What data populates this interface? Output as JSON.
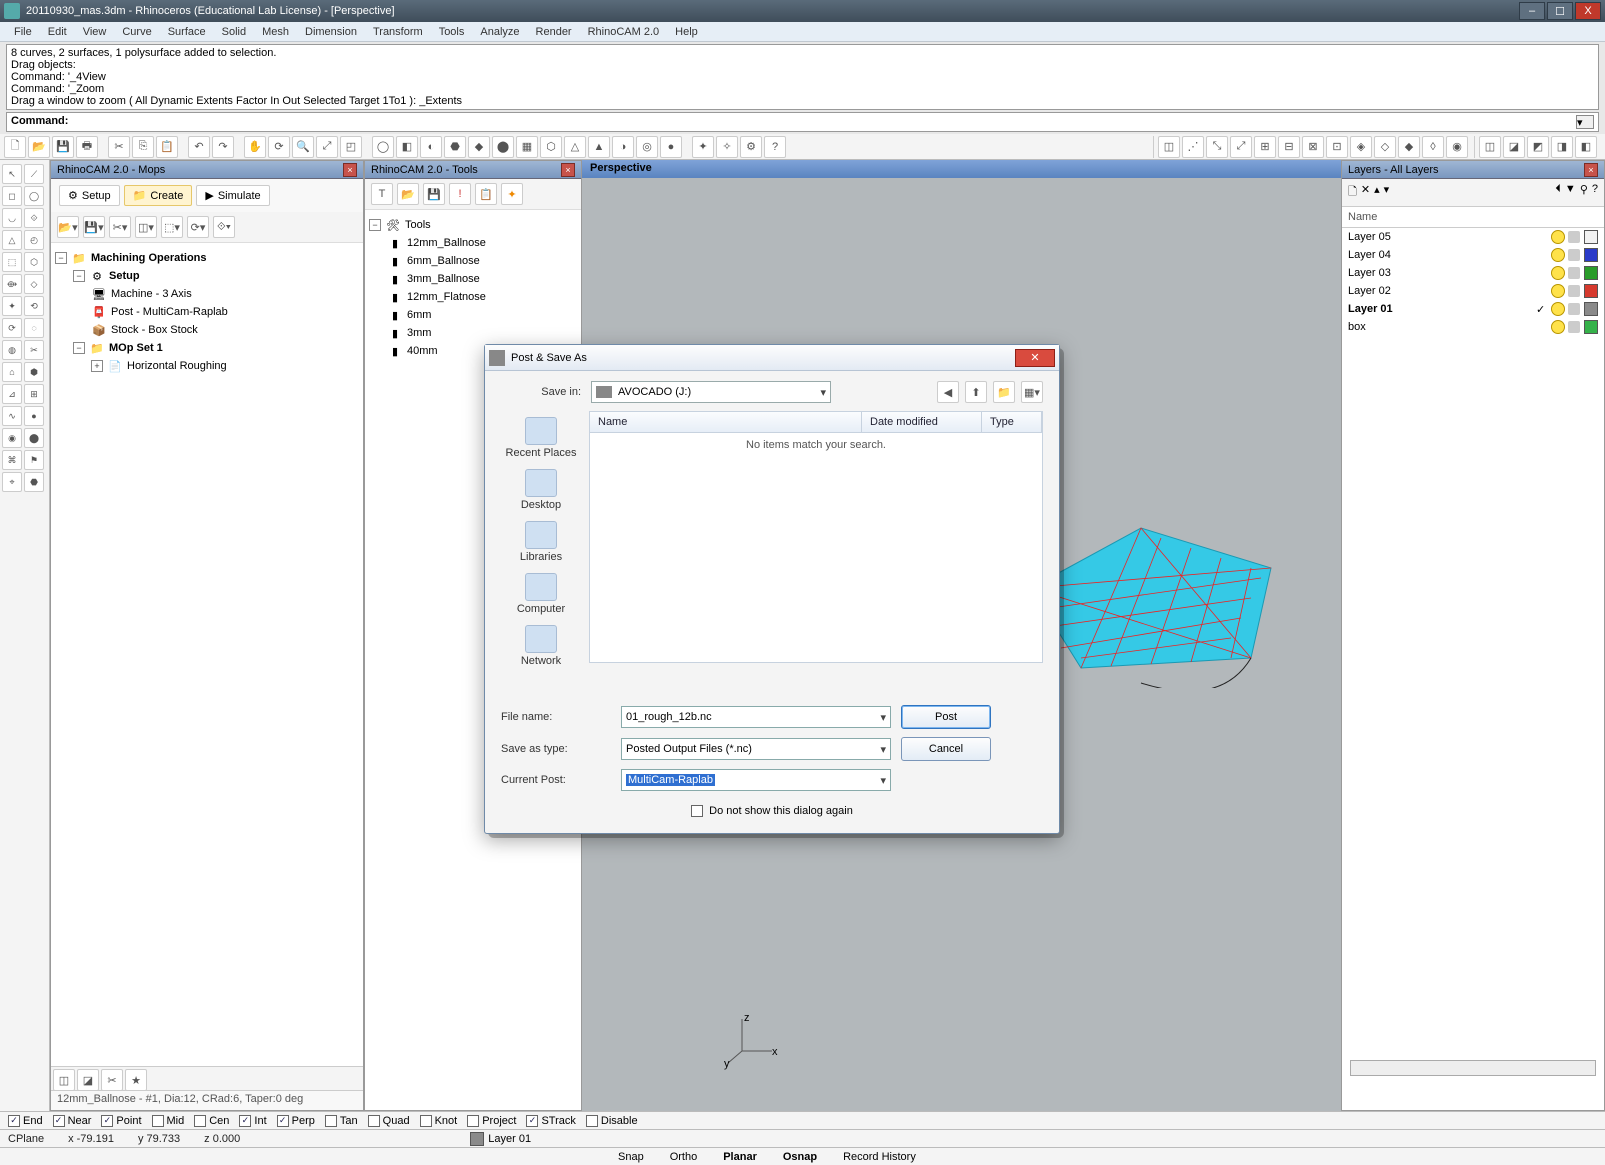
{
  "titlebar": {
    "text": "20110930_mas.3dm - Rhinoceros (Educational Lab License) - [Perspective]"
  },
  "window_controls": {
    "min": "–",
    "max": "☐",
    "close": "X"
  },
  "menu": [
    "File",
    "Edit",
    "View",
    "Curve",
    "Surface",
    "Solid",
    "Mesh",
    "Dimension",
    "Transform",
    "Tools",
    "Analyze",
    "Render",
    "RhinoCAM 2.0",
    "Help"
  ],
  "command_history": [
    "8 curves, 2 surfaces, 1 polysurface added to selection.",
    "Drag objects:",
    "Command: '_4View",
    "Command: '_Zoom",
    "Drag a window to zoom ( All  Dynamic  Extents  Factor  In  Out  Selected  Target  1To1 ):  _Extents"
  ],
  "command_prompt": "Command:",
  "viewport_label": "Perspective",
  "mops_panel": {
    "title": "RhinoCAM 2.0 - Mops",
    "tabs": {
      "setup": "Setup",
      "create": "Create",
      "simulate": "Simulate"
    },
    "tree": {
      "root": "Machining Operations",
      "setup": "Setup",
      "machine": "Machine - 3 Axis",
      "post": "Post - MultiCam-Raplab",
      "stock": "Stock - Box Stock",
      "mopset": "MOp Set 1",
      "hrough": "Horizontal Roughing"
    },
    "status": "12mm_Ballnose - #1, Dia:12, CRad:6, Taper:0 deg"
  },
  "tools_panel": {
    "title": "RhinoCAM 2.0 - Tools",
    "root": "Tools",
    "items": [
      "12mm_Ballnose",
      "6mm_Ballnose",
      "3mm_Ballnose",
      "12mm_Flatnose",
      "6mm",
      "3mm",
      "40mm"
    ]
  },
  "layers_panel": {
    "title": "Layers - All Layers",
    "col_name": "Name",
    "rows": [
      {
        "name": "box",
        "color": "#35b24a",
        "bold": false,
        "active": false
      },
      {
        "name": "Layer 01",
        "color": "#8a8a8a",
        "bold": true,
        "active": true
      },
      {
        "name": "Layer 02",
        "color": "#d63a2e",
        "bold": false,
        "active": false
      },
      {
        "name": "Layer 03",
        "color": "#2a9c2a",
        "bold": false,
        "active": false
      },
      {
        "name": "Layer 04",
        "color": "#2a3bc9",
        "bold": false,
        "active": false
      },
      {
        "name": "Layer 05",
        "color": "#f2f2f2",
        "bold": false,
        "active": false
      }
    ]
  },
  "dialog": {
    "title": "Post & Save As",
    "save_in_label": "Save in:",
    "drive": "AVOCADO (J:)",
    "cols": {
      "name": "Name",
      "date": "Date modified",
      "type": "Type"
    },
    "empty": "No items match your search.",
    "places": [
      "Recent Places",
      "Desktop",
      "Libraries",
      "Computer",
      "Network"
    ],
    "file_name_label": "File name:",
    "file_name": "01_rough_12b.nc",
    "save_type_label": "Save as type:",
    "save_type": "Posted Output Files (*.nc)",
    "current_post_label": "Current Post:",
    "current_post": "MultiCam-Raplab",
    "do_not_show": "Do not show this dialog again",
    "post_btn": "Post",
    "cancel_btn": "Cancel"
  },
  "osnaps": [
    {
      "label": "End",
      "on": true
    },
    {
      "label": "Near",
      "on": true
    },
    {
      "label": "Point",
      "on": true
    },
    {
      "label": "Mid",
      "on": false
    },
    {
      "label": "Cen",
      "on": false
    },
    {
      "label": "Int",
      "on": true
    },
    {
      "label": "Perp",
      "on": true
    },
    {
      "label": "Tan",
      "on": false
    },
    {
      "label": "Quad",
      "on": false
    },
    {
      "label": "Knot",
      "on": false
    },
    {
      "label": "Project",
      "on": false
    },
    {
      "label": "STrack",
      "on": true
    },
    {
      "label": "Disable",
      "on": false
    }
  ],
  "status1": {
    "cplane": "CPlane",
    "x": "x -79.191",
    "y": "y 79.733",
    "z": "z 0.000",
    "layer_box": "Layer 01"
  },
  "status2": {
    "items": [
      {
        "t": "Snap",
        "b": false
      },
      {
        "t": "Ortho",
        "b": false
      },
      {
        "t": "Planar",
        "b": true
      },
      {
        "t": "Osnap",
        "b": true
      },
      {
        "t": "Record History",
        "b": false
      }
    ]
  }
}
